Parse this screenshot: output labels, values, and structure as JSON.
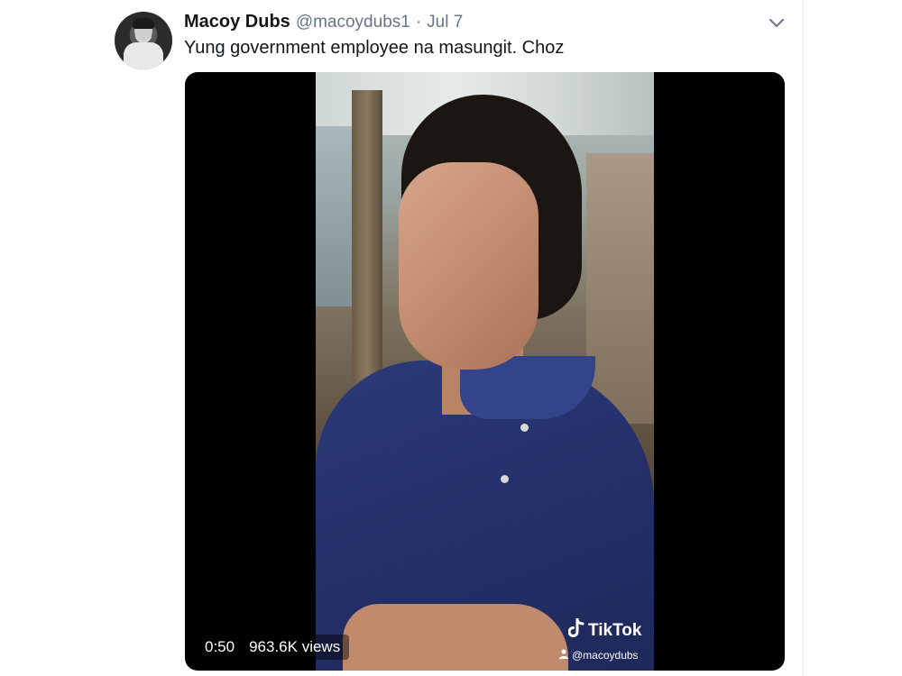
{
  "tweet": {
    "author_name": "Macoy Dubs",
    "author_handle": "@macoydubs1",
    "separator": "·",
    "date": "Jul 7",
    "text": "Yung government employee na masungit. Choz"
  },
  "video": {
    "duration": "0:50",
    "views": "963.6K views",
    "watermark": {
      "brand": "TikTok",
      "handle": "@macoydubs"
    }
  },
  "icons": {
    "more": "chevron-down-icon",
    "tiktok": "tiktok-logo-icon",
    "user": "user-icon"
  },
  "colors": {
    "text_primary": "#14171a",
    "text_secondary": "#657786",
    "media_bg": "#000000"
  }
}
